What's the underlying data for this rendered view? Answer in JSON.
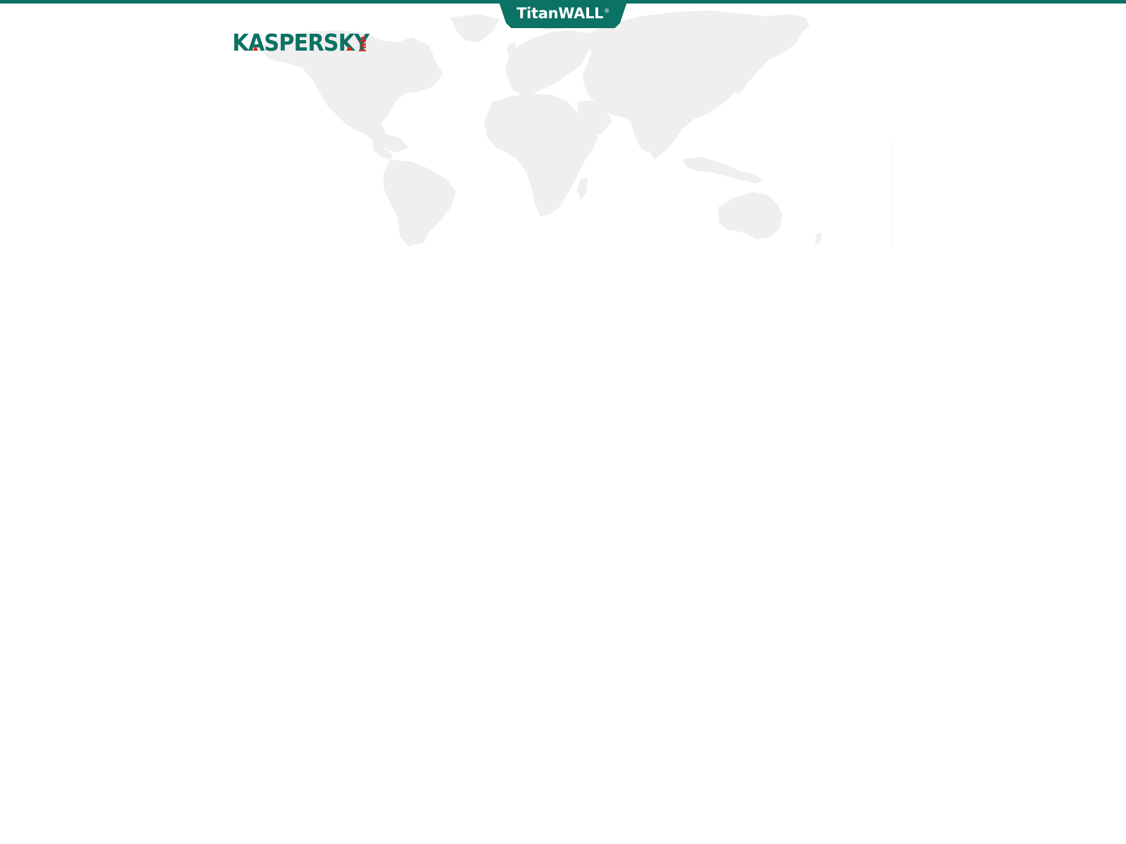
{
  "header": {
    "title": "TitanWALL",
    "title_mark": "®",
    "accent_color": "#0b7264"
  },
  "logo": {
    "wordmark": "KASPERSKY",
    "suffix": "lab",
    "primary_color": "#0b7264",
    "accent_color": "#e2231a"
  },
  "map": {
    "icon": "world-map",
    "fill_color": "#efefef"
  }
}
